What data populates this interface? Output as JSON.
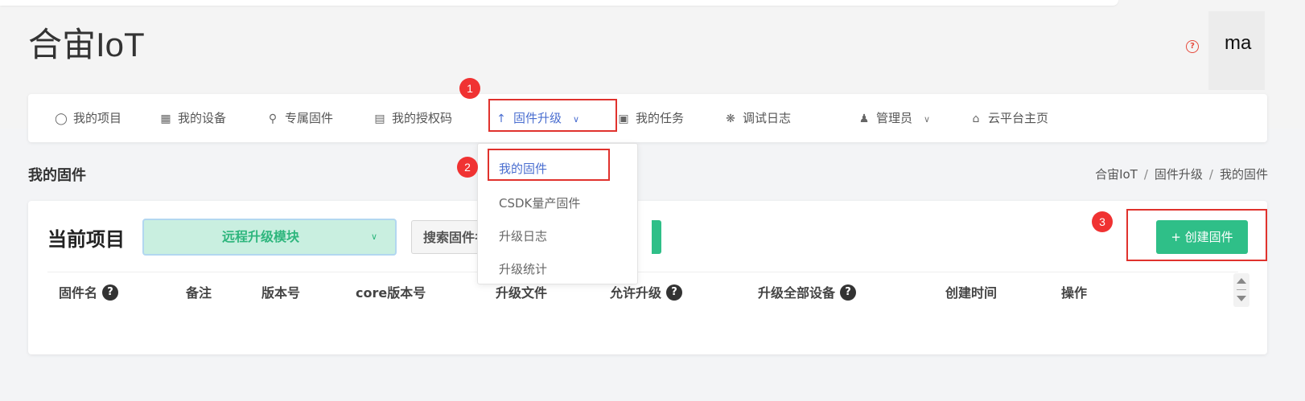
{
  "header": {
    "brand": "合宙IoT",
    "help_icon": "question-circle-icon",
    "user": "ma"
  },
  "nav": [
    {
      "label": "我的项目",
      "icon": "lightbulb-icon"
    },
    {
      "label": "我的设备",
      "icon": "chip-icon"
    },
    {
      "label": "专属固件",
      "icon": "key-icon"
    },
    {
      "label": "我的授权码",
      "icon": "card-icon"
    },
    {
      "label": "固件升级",
      "icon": "arrow-up-icon",
      "active": true,
      "has_dropdown": true
    },
    {
      "label": "我的任务",
      "icon": "calendar-icon"
    },
    {
      "label": "调试日志",
      "icon": "bug-icon"
    },
    {
      "label": "管理员",
      "icon": "user-icon",
      "has_dropdown": true
    },
    {
      "label": "云平台主页",
      "icon": "home-icon"
    }
  ],
  "dropdown": [
    {
      "label": "我的固件",
      "active": true
    },
    {
      "label": "CSDK量产固件"
    },
    {
      "label": "升级日志"
    },
    {
      "label": "升级统计"
    }
  ],
  "steps": [
    "1",
    "2",
    "3"
  ],
  "page": {
    "title": "我的固件",
    "breadcrumb": [
      "合宙IoT",
      "固件升级",
      "我的固件"
    ]
  },
  "toolbar": {
    "project_label": "当前项目",
    "project_value": "远程升级模块",
    "search_label": "搜索固件名",
    "create_button": "+ 创建固件"
  },
  "table": {
    "columns": [
      {
        "label": "固件名",
        "help": true
      },
      {
        "label": "备注"
      },
      {
        "label": "版本号"
      },
      {
        "label": "core版本号"
      },
      {
        "label": "升级文件"
      },
      {
        "label": "允许升级",
        "help": true
      },
      {
        "label": "升级全部设备",
        "help": true
      },
      {
        "label": "创建时间"
      },
      {
        "label": "操作"
      }
    ]
  },
  "colors": {
    "accent": "#4a6ed0",
    "primary_green": "#2fbf88",
    "highlight_red": "#e0322d"
  }
}
